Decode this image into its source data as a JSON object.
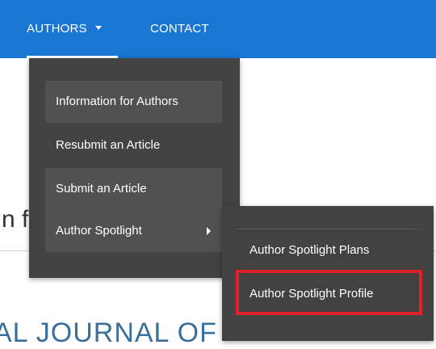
{
  "navbar": {
    "authors_label": "AUTHORS",
    "contact_label": "CONTACT"
  },
  "background": {
    "fragment_text": "n f",
    "journal_text": "AL JOURNAL OF"
  },
  "dropdown": {
    "items": [
      {
        "label": "Information for Authors"
      },
      {
        "label": "Resubmit an Article"
      },
      {
        "label": "Submit an Article"
      },
      {
        "label": "Author Spotlight"
      }
    ]
  },
  "submenu": {
    "items": [
      {
        "label": "Author Spotlight Plans"
      },
      {
        "label": "Author Spotlight Profile"
      }
    ]
  },
  "colors": {
    "navbar": "#1976d2",
    "menu_bg": "#424242",
    "menu_item_shaded": "#515151",
    "highlight": "#e0202a"
  },
  "icons": {
    "authors_caret": "caret-down-icon",
    "spotlight_arrow": "chevron-right-icon"
  }
}
